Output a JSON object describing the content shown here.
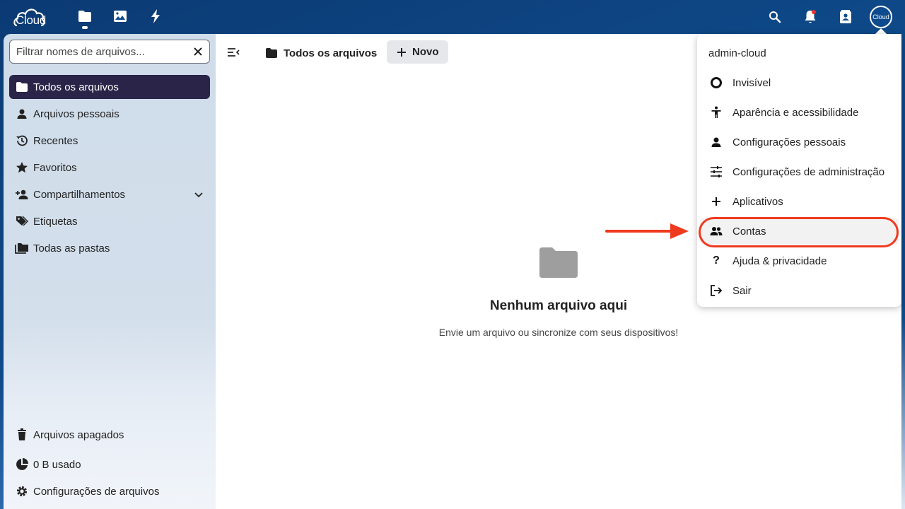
{
  "header": {
    "logo_text": "Cloud",
    "apps": [
      {
        "icon": "folder-icon"
      },
      {
        "icon": "image-icon"
      },
      {
        "icon": "lightning-icon"
      }
    ],
    "right_icons": [
      "search-icon",
      "bell-icon",
      "contacts-icon"
    ],
    "avatar_text": "Cloud",
    "colors": {
      "bg": "#0f4a8a",
      "notification": "#e9322d"
    }
  },
  "sidebar": {
    "filter_placeholder": "Filtrar nomes de arquivos...",
    "items": [
      {
        "label": "Todos os arquivos",
        "icon": "folder-icon",
        "active": true
      },
      {
        "label": "Arquivos pessoais",
        "icon": "user-icon"
      },
      {
        "label": "Recentes",
        "icon": "history-icon"
      },
      {
        "label": "Favoritos",
        "icon": "star-icon"
      },
      {
        "label": "Compartilhamentos",
        "icon": "share-user-icon",
        "expandable": true
      },
      {
        "label": "Etiquetas",
        "icon": "tags-icon"
      },
      {
        "label": "Todas as pastas",
        "icon": "folders-icon"
      }
    ],
    "footer": [
      {
        "label": "Arquivos apagados",
        "icon": "trash-icon"
      },
      {
        "label": "0 B usado",
        "icon": "pie-chart-icon"
      },
      {
        "label": "Configurações de arquivos",
        "icon": "gear-icon"
      }
    ],
    "active_color": "#2a2449"
  },
  "main": {
    "breadcrumb": "Todos os arquivos",
    "new_label": "Novo",
    "empty_title": "Nenhum arquivo aqui",
    "empty_subtitle": "Envie um arquivo ou sincronize com seus dispositivos!"
  },
  "user_menu": {
    "username": "admin-cloud",
    "items": [
      {
        "label": "Invisível",
        "icon": "status-ring-icon"
      },
      {
        "label": "Aparência e acessibilidade",
        "icon": "accessibility-icon"
      },
      {
        "label": "Configurações pessoais",
        "icon": "user-icon"
      },
      {
        "label": "Configurações de administração",
        "icon": "sliders-icon"
      },
      {
        "label": "Aplicativos",
        "icon": "plus-icon"
      },
      {
        "label": "Contas",
        "icon": "users-icon",
        "highlighted": true
      },
      {
        "label": "Ajuda & privacidade",
        "icon": "question-icon"
      },
      {
        "label": "Sair",
        "icon": "logout-icon"
      }
    ],
    "annotation_color": "#ef3a1f"
  }
}
